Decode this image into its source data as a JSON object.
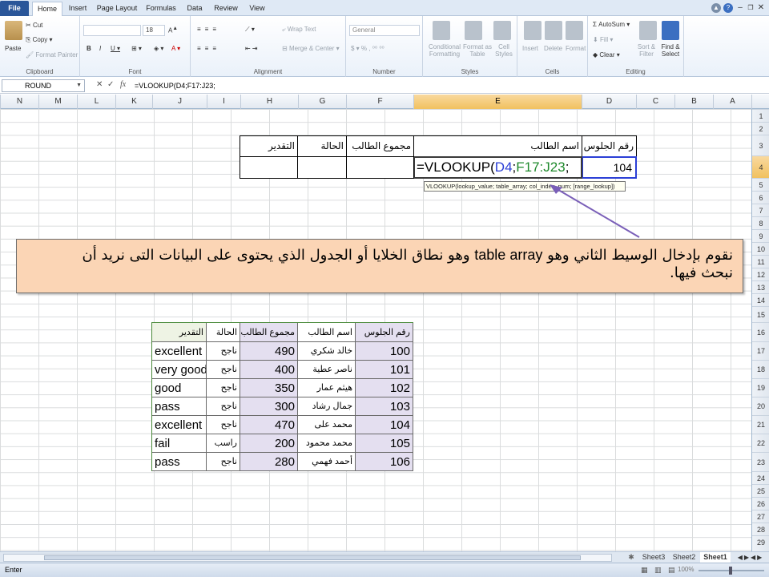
{
  "ribbon_tabs": [
    "File",
    "Home",
    "Insert",
    "Page Layout",
    "Formulas",
    "Data",
    "Review",
    "View"
  ],
  "clipboard": {
    "paste": "Paste",
    "cut": "Cut",
    "copy": "Copy",
    "format_painter": "Format Painter",
    "label": "Clipboard"
  },
  "font": {
    "size": "18",
    "label": "Font"
  },
  "alignment": {
    "wrap": "Wrap Text",
    "merge": "Merge & Center",
    "label": "Alignment"
  },
  "number": {
    "format": "General",
    "label": "Number"
  },
  "styles": {
    "conditional": "Conditional Formatting",
    "format_table": "Format as Table",
    "cell_styles": "Cell Styles",
    "label": "Styles"
  },
  "cells": {
    "insert": "Insert",
    "delete": "Delete",
    "format": "Format",
    "label": "Cells"
  },
  "editing": {
    "autosum": "AutoSum",
    "fill": "Fill",
    "clear": "Clear",
    "sort": "Sort & Filter",
    "find": "Find & Select",
    "label": "Editing"
  },
  "formula_bar": {
    "name_box": "ROUND",
    "formula": "=VLOOKUP(D4;F17:J23;"
  },
  "columns": [
    "N",
    "M",
    "L",
    "K",
    "J",
    "I",
    "H",
    "G",
    "F",
    "E",
    "D",
    "C",
    "B",
    "A"
  ],
  "rows": [
    "1",
    "2",
    "3",
    "4",
    "5",
    "6",
    "7",
    "8",
    "9",
    "10",
    "11",
    "12",
    "13",
    "14",
    "15",
    "16",
    "17",
    "18",
    "19",
    "20",
    "21",
    "22",
    "23",
    "24",
    "25",
    "26",
    "27",
    "28",
    "29"
  ],
  "lookup": {
    "headers": [
      "رقم الجلوس",
      "اسم الطالب",
      "مجموع الطالب",
      "الحالة",
      "التقدير"
    ],
    "seat_value": "104",
    "formula_parts": [
      "=VLOOKUP(",
      "D4",
      ";",
      "F17:J23",
      ";"
    ],
    "tooltip": "VLOOKUP(lookup_value; table_array; col_index_num; [range_lookup])"
  },
  "callout": {
    "line1_a": "نقوم بإدخال الوسيط الثاني وهو",
    "keyword": "table array",
    "line1_b": "وهو نطاق الخلايا أو الجدول الذي يحتوى على البيانات التى نريد أن",
    "line2": "نبحث فيها."
  },
  "table": {
    "headers": [
      "رقم الجلوس",
      "اسم الطالب",
      "مجموع الطالب",
      "الحالة",
      "التقدير"
    ],
    "rows": [
      [
        "100",
        "خالد شكري",
        "490",
        "ناجح",
        "excellent"
      ],
      [
        "101",
        "ناصر عطية",
        "400",
        "ناجح",
        "very good"
      ],
      [
        "102",
        "هيثم عمار",
        "350",
        "ناجح",
        "good"
      ],
      [
        "103",
        "جمال رشاد",
        "300",
        "ناجح",
        "pass"
      ],
      [
        "104",
        "محمد على",
        "470",
        "ناجح",
        "excellent"
      ],
      [
        "105",
        "محمد محمود",
        "200",
        "راسب",
        "fail"
      ],
      [
        "106",
        "أحمد فهمي",
        "280",
        "ناجح",
        "pass"
      ]
    ]
  },
  "sheets": [
    "Sheet3",
    "Sheet2",
    "Sheet1"
  ],
  "status": {
    "mode": "Enter",
    "zoom": "100%"
  },
  "colors": {
    "accent": "#2a5699",
    "callout": "#fbd5b5",
    "table_fill": "#e4dff0",
    "ref_blue": "#2b3fd6",
    "ref_green": "#1f8a2c"
  }
}
